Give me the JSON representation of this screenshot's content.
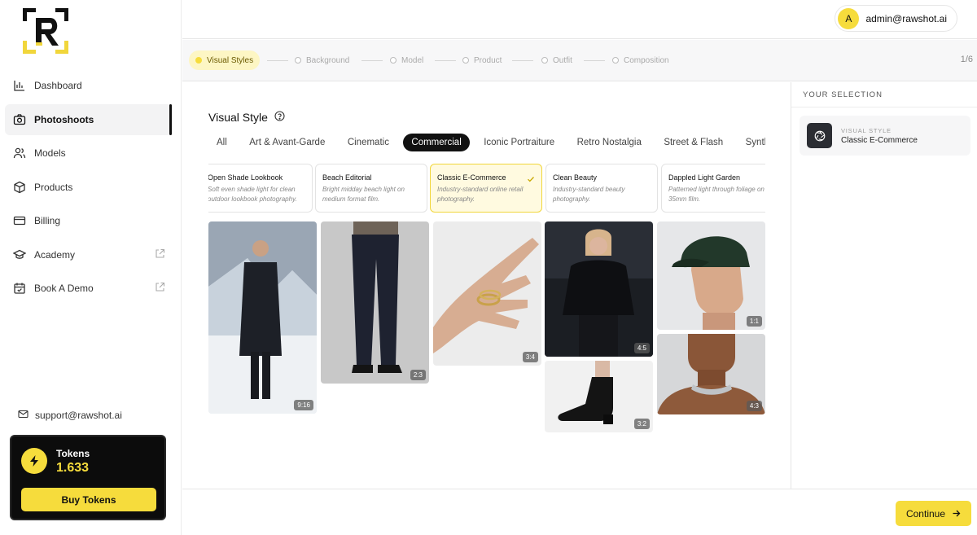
{
  "brand": {
    "logo_letter": "R"
  },
  "sidebar": {
    "items": [
      {
        "label": "Dashboard",
        "icon": "bar-chart-icon"
      },
      {
        "label": "Photoshoots",
        "icon": "camera-icon"
      },
      {
        "label": "Models",
        "icon": "users-icon"
      },
      {
        "label": "Products",
        "icon": "box-icon"
      },
      {
        "label": "Billing",
        "icon": "credit-card-icon"
      },
      {
        "label": "Academy",
        "icon": "graduation-cap-icon"
      },
      {
        "label": "Book A Demo",
        "icon": "calendar-check-icon"
      }
    ],
    "support_email": "support@rawshot.ai",
    "tokens": {
      "label": "Tokens",
      "value": "1.633",
      "buy_label": "Buy Tokens"
    }
  },
  "header": {
    "user_initial": "A",
    "user_email": "admin@rawshot.ai"
  },
  "stepper": {
    "steps": [
      "Visual Styles",
      "Background",
      "Model",
      "Product",
      "Outfit",
      "Composition"
    ],
    "count": "1/6"
  },
  "main": {
    "title": "Visual Style",
    "tabs": [
      "All",
      "Art & Avant-Garde",
      "Cinematic",
      "Commercial",
      "Iconic Portraiture",
      "Retro Nostalgia",
      "Street & Flash",
      "Synth"
    ],
    "active_tab": "Commercial",
    "style_cards": [
      {
        "name": "Open Shade Lookbook",
        "desc": "Soft even shade light for clean outdoor lookbook photography."
      },
      {
        "name": "Beach Editorial",
        "desc": "Bright midday beach light on medium format film."
      },
      {
        "name": "Classic E-Commerce",
        "desc": "Industry-standard online retail photography.",
        "selected": true
      },
      {
        "name": "Clean Beauty",
        "desc": "Industry-standard beauty photography."
      },
      {
        "name": "Dappled Light Garden",
        "desc": "Patterned light through foliage on 35mm film."
      }
    ],
    "gallery_ratios": [
      "9:16",
      "2:3",
      "3:4",
      "4:5",
      "3:2",
      "1:1",
      "4:3"
    ]
  },
  "selection": {
    "title": "YOUR SELECTION",
    "label": "VISUAL STYLE",
    "value": "Classic E-Commerce"
  },
  "footer": {
    "continue_label": "Continue"
  },
  "colors": {
    "accent": "#f6dc3c",
    "dark": "#111111"
  }
}
